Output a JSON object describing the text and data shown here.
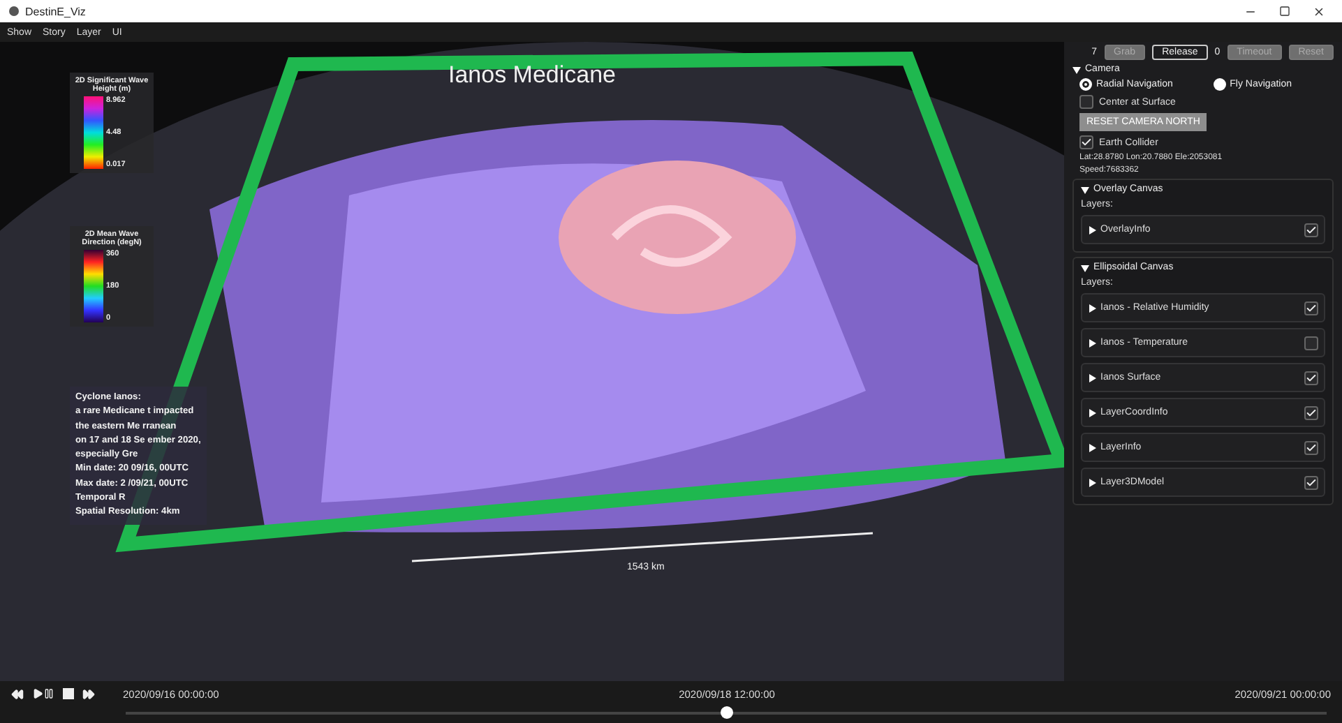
{
  "window": {
    "title": "DestinE_Viz"
  },
  "menu": [
    "Show",
    "Story",
    "Layer",
    "UI"
  ],
  "scene": {
    "title": "Ianos Medicane",
    "scale_label": "1543 km",
    "legends": [
      {
        "title": "2D Significant Wave Height (m)",
        "kind": "height",
        "max": "8.962",
        "mid": "4.48",
        "min": "0.017"
      },
      {
        "title": "2D Mean Wave Direction (degN)",
        "kind": "direction",
        "max": "360",
        "mid": "180",
        "min": "0"
      }
    ],
    "info_lines": [
      "Cyclone Ianos:",
      "a rare Medicane t impacted",
      "the eastern Me rranean",
      "on 17 and 18 Se ember 2020,",
      "especially Gre",
      "Min date: 20 09/16, 00UTC",
      "Max date: 2 /09/21, 00UTC",
      "Temporal R",
      "Spatial Resolution: 4km"
    ]
  },
  "toolbar": [
    {
      "kind": "count",
      "text": "7"
    },
    {
      "kind": "button",
      "text": "Grab",
      "disabled": true
    },
    {
      "kind": "button",
      "text": "Release",
      "disabled": false
    },
    {
      "kind": "count",
      "text": "0"
    },
    {
      "kind": "button",
      "text": "Timeout",
      "disabled": true
    },
    {
      "kind": "button",
      "text": "Reset",
      "disabled": true
    }
  ],
  "camera": {
    "title": "Camera",
    "expanded": true,
    "navigation": [
      {
        "label": "Radial Navigation",
        "selected": true
      },
      {
        "label": "Fly Navigation",
        "selected": false
      }
    ],
    "center_at_surface": {
      "label": "Center at Surface",
      "checked": false
    },
    "reset_button": {
      "label": "RESET CAMERA NORTH",
      "disabled": true
    },
    "earth_collider": {
      "label": "Earth Collider",
      "checked": true
    },
    "position": "Lat:28.8780  Lon:20.7880  Ele:2053081",
    "speed": "Speed:7683362"
  },
  "canvases": [
    {
      "title": "Overlay Canvas",
      "expanded": true,
      "layers_label": "Layers:",
      "layers": [
        {
          "name": "OverlayInfo",
          "checked": true
        }
      ]
    },
    {
      "title": "Ellipsoidal Canvas",
      "expanded": true,
      "layers_label": "Layers:",
      "layers": [
        {
          "name": "Ianos - Relative Humidity",
          "checked": true
        },
        {
          "name": "Ianos - Temperature",
          "checked": false
        },
        {
          "name": "Ianos Surface",
          "checked": true
        },
        {
          "name": "LayerCoordInfo",
          "checked": true
        },
        {
          "name": "LayerInfo",
          "checked": true
        },
        {
          "name": "Layer3DModel",
          "checked": true
        }
      ]
    }
  ],
  "timeline": {
    "start": "2020/09/16 00:00:00",
    "current": "2020/09/18 12:00:00",
    "end": "2020/09/21 00:00:00",
    "level": 0.5
  }
}
